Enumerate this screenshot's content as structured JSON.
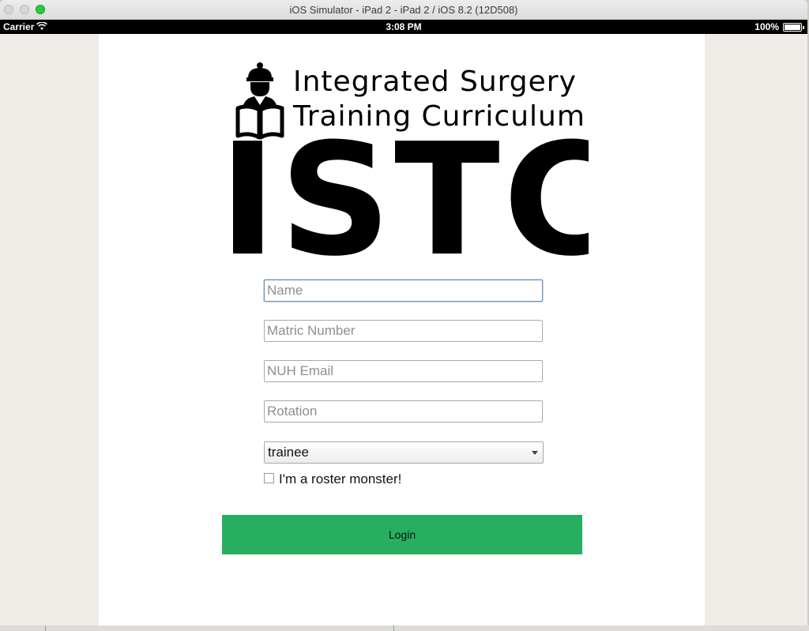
{
  "window": {
    "title": "iOS Simulator - iPad 2 - iPad 2 / iOS 8.2 (12D508)"
  },
  "status_bar": {
    "carrier": "Carrier",
    "time": "3:08 PM",
    "battery": "100%"
  },
  "logo": {
    "line1": "Integrated Surgery",
    "line2": "Training Curriculum",
    "acronym": "ISTC"
  },
  "form": {
    "name_placeholder": "Name",
    "matric_placeholder": "Matric Number",
    "email_placeholder": "NUH Email",
    "rotation_placeholder": "Rotation",
    "role_selected": "trainee",
    "roster_label": "I'm a roster monster!",
    "login_label": "Login"
  },
  "colors": {
    "login_button": "#27ae60"
  }
}
